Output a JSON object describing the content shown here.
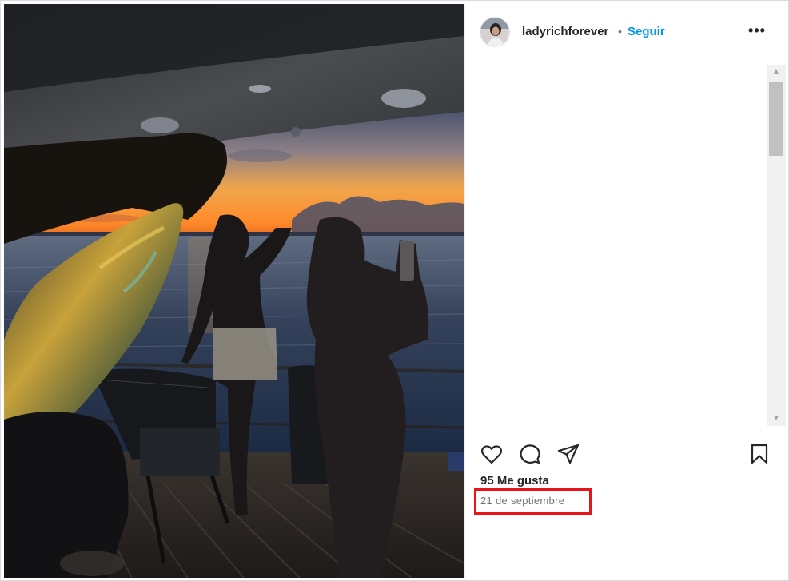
{
  "post": {
    "username": "ladyrichforever",
    "separator": "•",
    "follow_label": "Seguir",
    "more_label": "•••",
    "likes_text": "95 Me gusta",
    "date_text": "21 de septiembre"
  },
  "icons": {
    "like": "heart-icon",
    "comment": "comment-bubble-icon",
    "share": "paper-plane-icon",
    "save": "bookmark-icon",
    "more": "more-options-icon"
  },
  "colors": {
    "accent": "#0095f6",
    "highlight": "#e8141c",
    "text": "#262626",
    "muted": "#737373"
  }
}
